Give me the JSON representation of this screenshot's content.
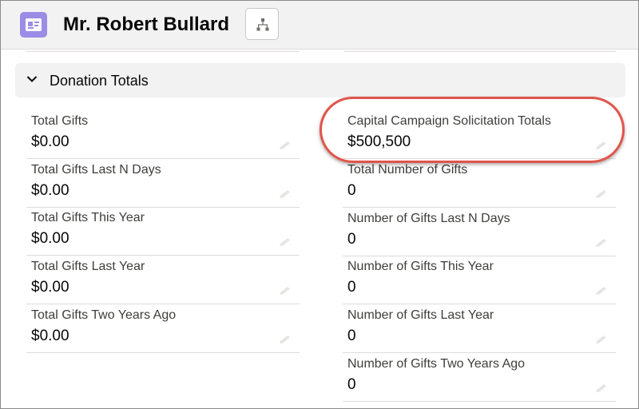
{
  "header": {
    "title": "Mr. Robert Bullard",
    "icon": "contact-card-icon",
    "hierarchy_icon": "hierarchy-icon"
  },
  "section": {
    "title": "Donation Totals",
    "icon": "chevron-down-icon"
  },
  "left_fields": [
    {
      "label": "Total Gifts",
      "value": "$0.00"
    },
    {
      "label": "Total Gifts Last N Days",
      "value": "$0.00"
    },
    {
      "label": "Total Gifts This Year",
      "value": "$0.00"
    },
    {
      "label": "Total Gifts Last Year",
      "value": "$0.00"
    },
    {
      "label": "Total Gifts Two Years Ago",
      "value": "$0.00"
    }
  ],
  "right_fields": [
    {
      "label": "Capital Campaign Solicitation Totals",
      "value": "$500,500"
    },
    {
      "label": "Total Number of Gifts",
      "value": "0"
    },
    {
      "label": "Number of Gifts Last N Days",
      "value": "0"
    },
    {
      "label": "Number of Gifts This Year",
      "value": "0"
    },
    {
      "label": "Number of Gifts Last Year",
      "value": "0"
    },
    {
      "label": "Number of Gifts Two Years Ago",
      "value": "0"
    }
  ],
  "colors": {
    "record_icon_bg": "#9b8ce6",
    "highlight": "#e0554a"
  }
}
